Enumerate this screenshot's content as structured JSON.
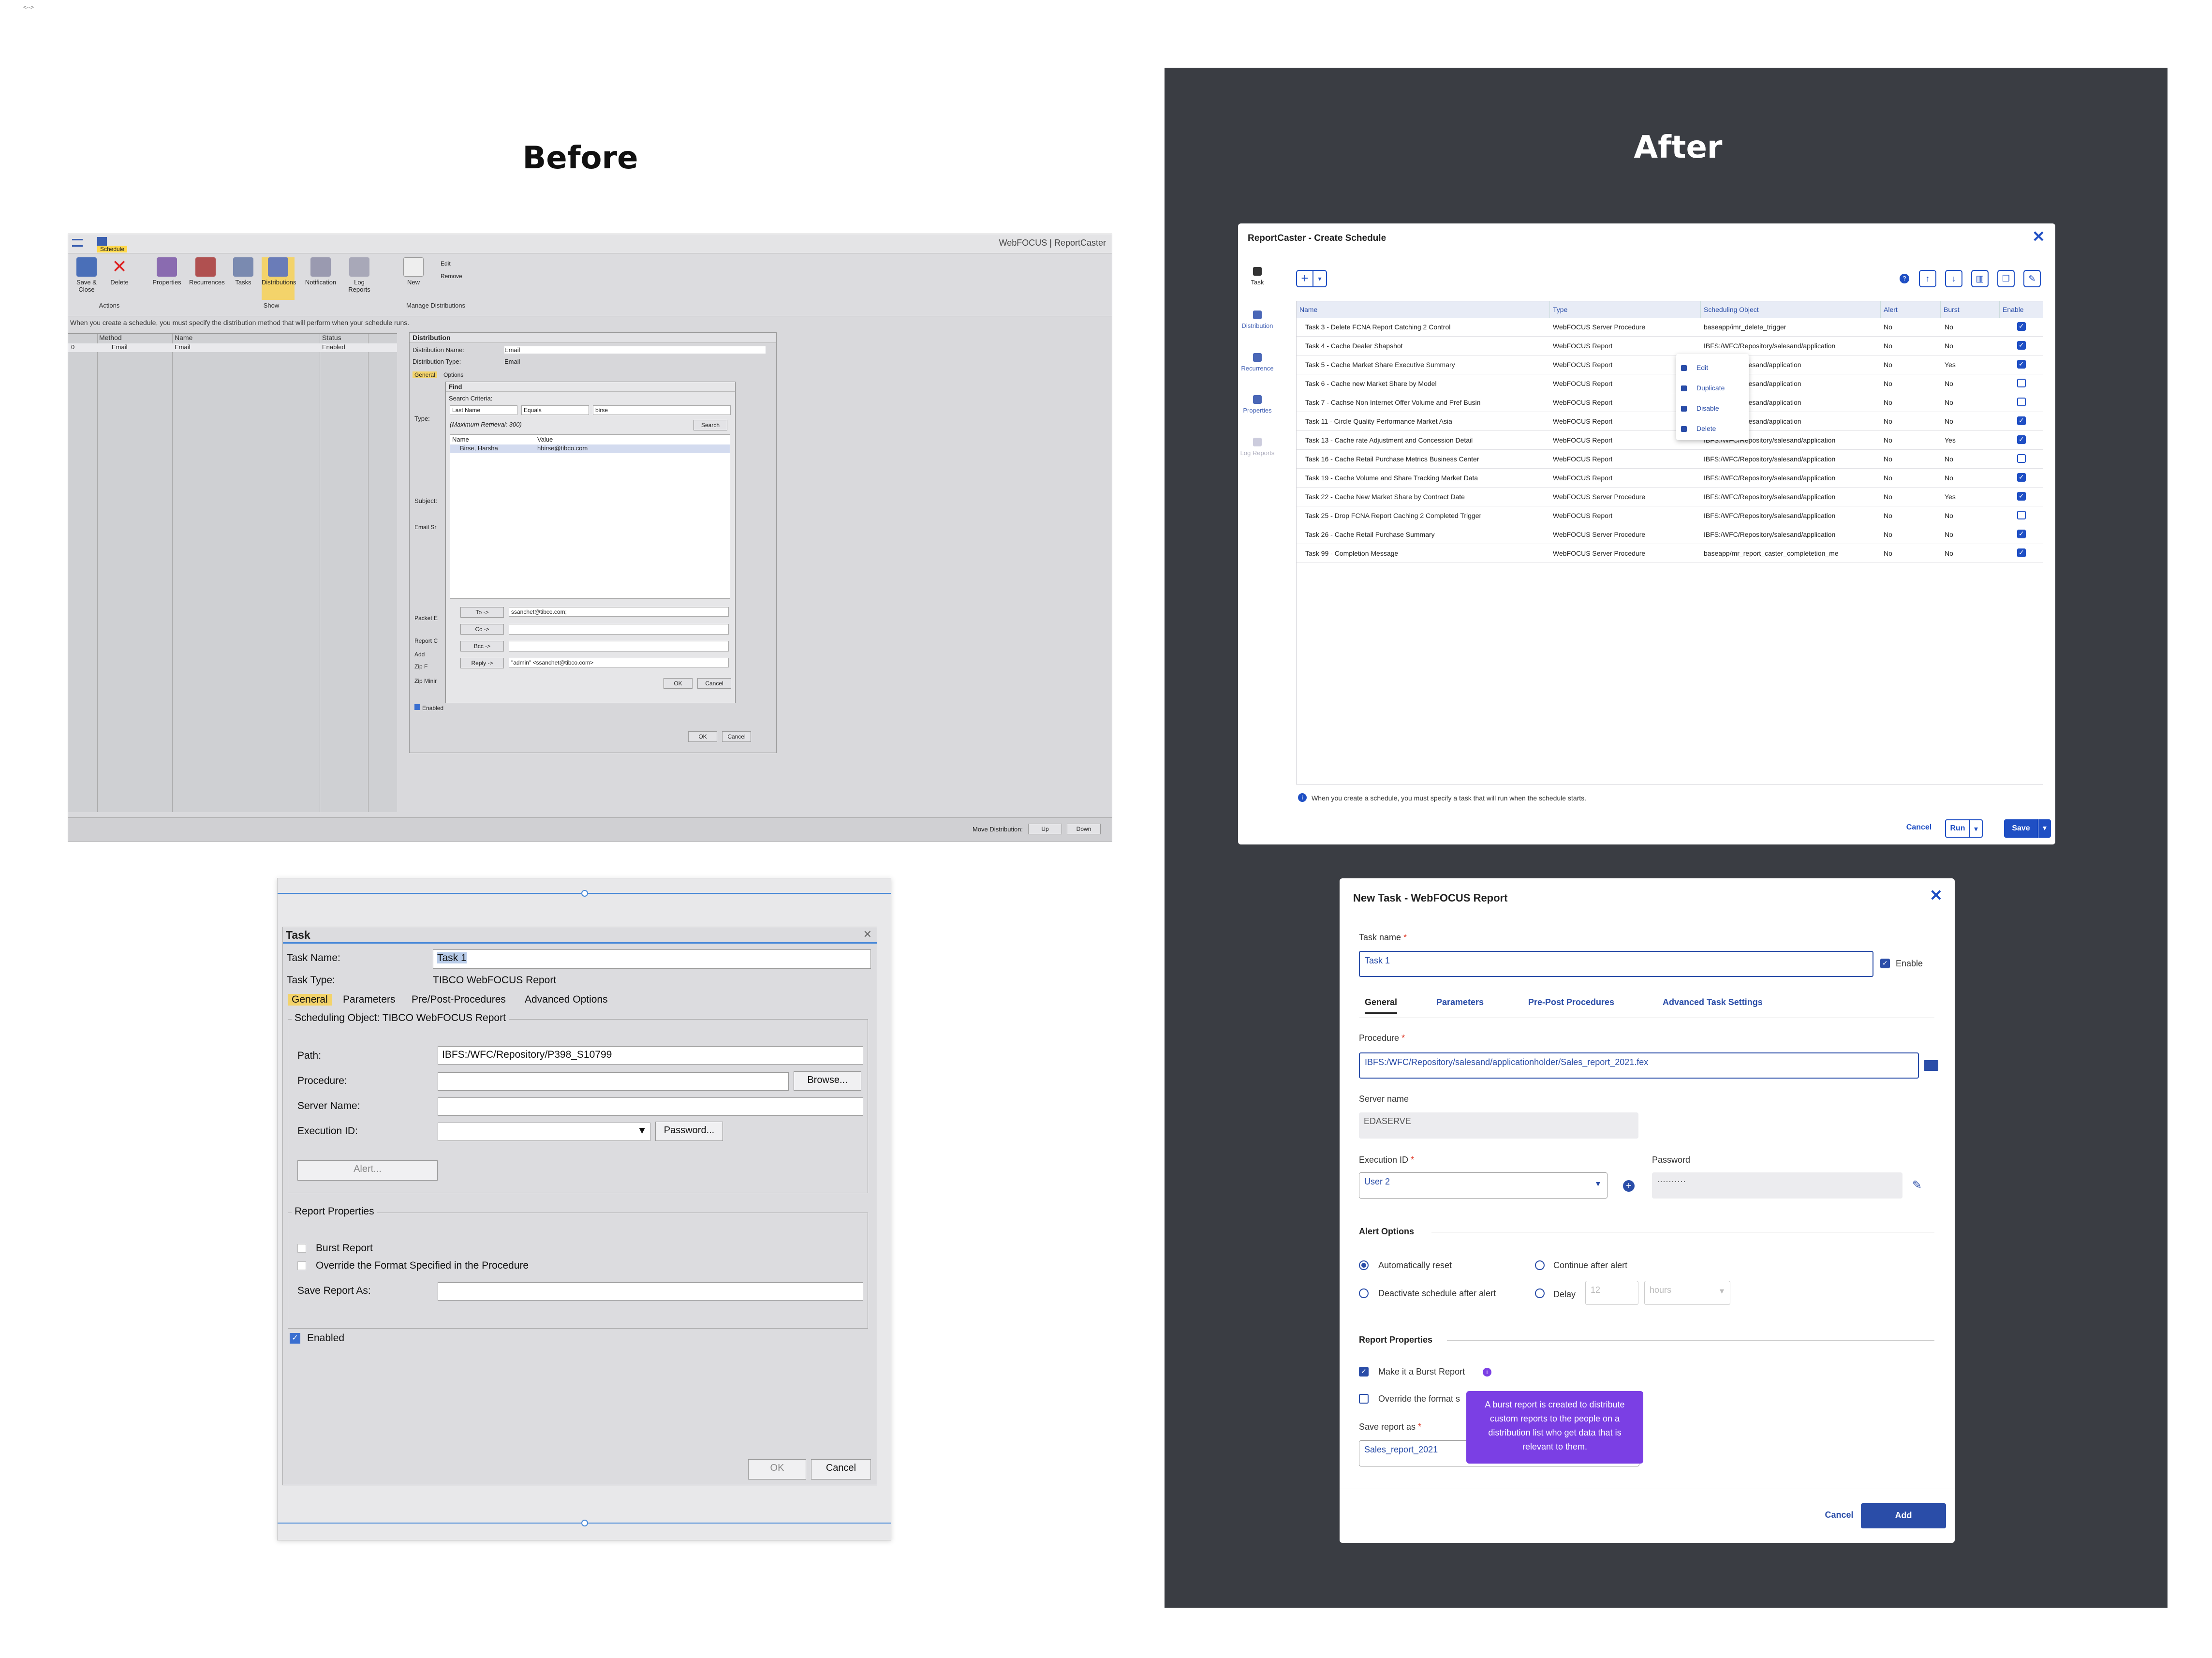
{
  "corner_glyph": "<-->",
  "headings": {
    "before": "Before",
    "after": "After"
  },
  "old_app": {
    "title": "WebFOCUS | ReportCaster",
    "tab": "Schedule",
    "ribbon": [
      {
        "label": "Save & Close"
      },
      {
        "label": "Delete"
      },
      {
        "label": "Properties"
      },
      {
        "label": "Recurrences"
      },
      {
        "label": "Tasks"
      },
      {
        "label": "Distributions"
      },
      {
        "label": "Notification"
      },
      {
        "label": "Log Reports"
      },
      {
        "label": "New"
      }
    ],
    "ribbon_small": {
      "edit": "Edit",
      "remove": "Remove"
    },
    "groups": {
      "actions": "Actions",
      "show": "Show",
      "manage": "Manage Distributions"
    },
    "hint": "When you create a schedule, you must specify the distribution method that will perform when your schedule runs.",
    "grid": {
      "headers": [
        "Method",
        "Name",
        "Status"
      ],
      "row": [
        "0",
        "Email",
        "Email",
        "Enabled"
      ]
    },
    "move_label": "Move Distribution:",
    "up": "Up",
    "down": "Down",
    "distribution": {
      "title": "Distribution",
      "name_label": "Distribution Name:",
      "name_value": "Email",
      "type_label": "Distribution Type:",
      "type_value": "Email",
      "tab_general": "General",
      "tab_options": "Options",
      "type_row": "Type:",
      "subject": "Subject:",
      "email_label": "Email Sr",
      "packet": "Packet E",
      "report": "Report C",
      "add": "Add",
      "zip": "Zip F",
      "zipmin": "Zip Minir",
      "enabled": "Enabled",
      "ok": "OK",
      "cancel": "Cancel"
    },
    "find": {
      "title": "Find",
      "criteria": "Search Criteria:",
      "field": "Last Name",
      "op": "Equals",
      "value": "birse",
      "max": "(Maximum Retrieval: 300)",
      "search": "Search",
      "col_name": "Name",
      "col_value": "Value",
      "result_name": "Birse, Harsha",
      "result_value": "hbirse@tibco.com",
      "to": "To ->",
      "to_val": "ssanchet@tibco.com;",
      "cc": "Cc ->",
      "bcc": "Bcc ->",
      "reply": "Reply ->",
      "reply_val": "\"admin\" <ssanchet@tibco.com>",
      "ok": "OK",
      "cancel": "Cancel"
    }
  },
  "old_task": {
    "title": "Task",
    "name_label": "Task Name:",
    "name_value": "Task 1",
    "type_label": "Task Type:",
    "type_value": "TIBCO WebFOCUS Report",
    "tabs": [
      "General",
      "Parameters",
      "Pre/Post-Procedures",
      "Advanced Options"
    ],
    "sched_group": "Scheduling Object: TIBCO WebFOCUS Report",
    "path_label": "Path:",
    "path_value": "IBFS:/WFC/Repository/P398_S10799",
    "procedure_label": "Procedure:",
    "browse": "Browse...",
    "server_label": "Server Name:",
    "exec_label": "Execution ID:",
    "password": "Password...",
    "alert": "Alert...",
    "report_group": "Report Properties",
    "burst": "Burst Report",
    "override": "Override the Format Specified in the Procedure",
    "save_as": "Save Report As:",
    "enabled": "Enabled",
    "ok": "OK",
    "cancel": "Cancel"
  },
  "schedule": {
    "title": "ReportCaster - Create Schedule",
    "sidebar": [
      "Task",
      "Distribution",
      "Recurrence",
      "Properties",
      "Log Reports"
    ],
    "headers": [
      "Name",
      "Type",
      "Scheduling Object",
      "Alert",
      "Burst",
      "Enable"
    ],
    "rows": [
      {
        "name": "Task 3 - Delete FCNA Report Catching 2 Control",
        "type": "WebFOCUS Server Procedure",
        "obj": "baseapp/imr_delete_trigger",
        "alert": "No",
        "burst": "No",
        "en": true
      },
      {
        "name": "Task 4 - Cache Dealer Shapshot",
        "type": "WebFOCUS Report",
        "obj": "IBFS:/WFC/Repository/salesand/application",
        "alert": "No",
        "burst": "No",
        "en": true
      },
      {
        "name": "Task 5 - Cache Market Share Executive Summary",
        "type": "WebFOCUS Report",
        "obj": "/Repository/salesand/application",
        "alert": "No",
        "burst": "Yes",
        "en": true
      },
      {
        "name": "Task 6 - Cache new Market Share by Model",
        "type": "WebFOCUS Report",
        "obj": "/Repository/salesand/application",
        "alert": "No",
        "burst": "No",
        "en": false
      },
      {
        "name": "Task 7 - Cachse Non Internet Offer Volume and Pref Busin",
        "type": "WebFOCUS Report",
        "obj": "/Repository/salesand/application",
        "alert": "No",
        "burst": "No",
        "en": false
      },
      {
        "name": "Task 11 - Circle Quality Performance Market Asia",
        "type": "WebFOCUS Report",
        "obj": "/Repository/salesand/application",
        "alert": "No",
        "burst": "No",
        "en": true
      },
      {
        "name": "Task 13 - Cache rate Adjustment and Concession Detail",
        "type": "WebFOCUS Report",
        "obj": "IBFS:/WFC/Repository/salesand/application",
        "alert": "No",
        "burst": "Yes",
        "en": true
      },
      {
        "name": "Task 16 - Cache Retail Purchase Metrics Business Center",
        "type": "WebFOCUS Report",
        "obj": "IBFS:/WFC/Repository/salesand/application",
        "alert": "No",
        "burst": "No",
        "en": false
      },
      {
        "name": "Task 19 - Cache Volume and Share Tracking Market Data",
        "type": "WebFOCUS Report",
        "obj": "IBFS:/WFC/Repository/salesand/application",
        "alert": "No",
        "burst": "No",
        "en": true
      },
      {
        "name": "Task 22 - Cache New Market Share by Contract Date",
        "type": "WebFOCUS Server Procedure",
        "obj": "IBFS:/WFC/Repository/salesand/application",
        "alert": "No",
        "burst": "Yes",
        "en": true
      },
      {
        "name": "Task 25 - Drop FCNA Report Caching 2 Completed Trigger",
        "type": "WebFOCUS Report",
        "obj": "IBFS:/WFC/Repository/salesand/application",
        "alert": "No",
        "burst": "No",
        "en": false
      },
      {
        "name": "Task 26 - Cache Retail Purchase Summary",
        "type": "WebFOCUS Server Procedure",
        "obj": "IBFS:/WFC/Repository/salesand/application",
        "alert": "No",
        "burst": "No",
        "en": true
      },
      {
        "name": "Task 99 - Completion Message",
        "type": "WebFOCUS Server Procedure",
        "obj": "baseapp/mr_report_caster_completetion_me",
        "alert": "No",
        "burst": "No",
        "en": true
      }
    ],
    "context_menu": [
      "Edit",
      "Duplicate",
      "Disable",
      "Delete"
    ],
    "info": "When you create a schedule, you must specify a task that will run when the schedule starts.",
    "cancel": "Cancel",
    "run": "Run",
    "save": "Save",
    "add_icon": "+"
  },
  "new_task": {
    "title": "New Task - WebFOCUS Report",
    "name_label": "Task name",
    "name_value": "Task 1",
    "enable": "Enable",
    "tabs": [
      "General",
      "Parameters",
      "Pre-Post Procedures",
      "Advanced Task Settings"
    ],
    "procedure_label": "Procedure",
    "procedure_value": "IBFS:/WFC/Repository/salesand/applicationholder/Sales_report_2021.fex",
    "server_label": "Server name",
    "server_value": "EDASERVE",
    "exec_label": "Execution ID",
    "exec_value": "User 2",
    "password_label": "Password",
    "password_value": "··········",
    "alert_title": "Alert Options",
    "alert_opts": [
      "Automatically reset",
      "Continue after alert",
      "Deactivate schedule after alert",
      "Delay"
    ],
    "delay_value": "12",
    "delay_unit": "hours",
    "report_title": "Report Properties",
    "burst": "Make it a Burst Report",
    "override": "Override the format s",
    "save_label": "Save report as",
    "save_value": "Sales_report_2021",
    "tooltip": "A burst report is created to distribute custom reports to the people on a distribution list who get data that is relevant to them.",
    "cancel": "Cancel",
    "add": "Add"
  },
  "colors": {
    "accent": "#1f4fc4",
    "dark_panel": "#3a3d43",
    "tooltip": "#7b3fe4"
  }
}
